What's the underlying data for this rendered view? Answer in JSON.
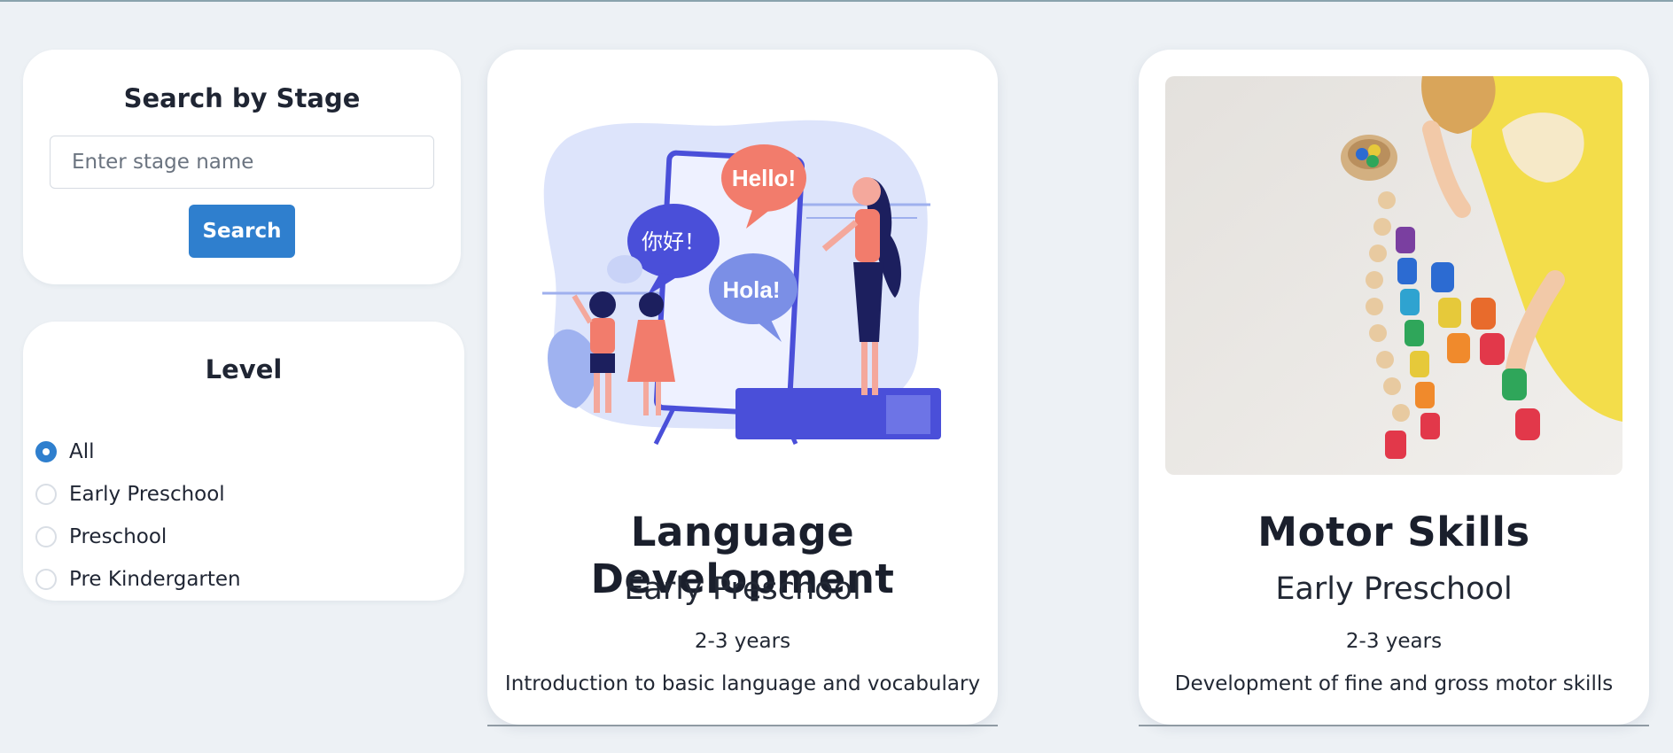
{
  "search": {
    "title": "Search by Stage",
    "placeholder": "Enter stage name",
    "value": "",
    "button_label": "Search"
  },
  "level": {
    "title": "Level",
    "selected": "All",
    "options": [
      {
        "label": "All",
        "checked": true
      },
      {
        "label": "Early Preschool",
        "checked": false
      },
      {
        "label": "Preschool",
        "checked": false
      },
      {
        "label": "Pre Kindergarten",
        "checked": false
      }
    ]
  },
  "cards": [
    {
      "title": "Language Development",
      "stage": "Early Preschool",
      "age": "2-3 years",
      "description": "Introduction to basic language and vocabulary",
      "image": "teacher-with-speech-bubbles-illustration",
      "bubbles": [
        "Hello!",
        "你好！",
        "Hola!"
      ]
    },
    {
      "title": "Motor Skills",
      "stage": "Early Preschool",
      "age": "2-3 years",
      "description": "Development of fine and gross motor skills",
      "image": "child-playing-with-colorful-wooden-cups-photo"
    }
  ],
  "colors": {
    "background": "#edf1f5",
    "accent": "#2f7fce",
    "card": "#ffffff",
    "text": "#1f2533"
  }
}
